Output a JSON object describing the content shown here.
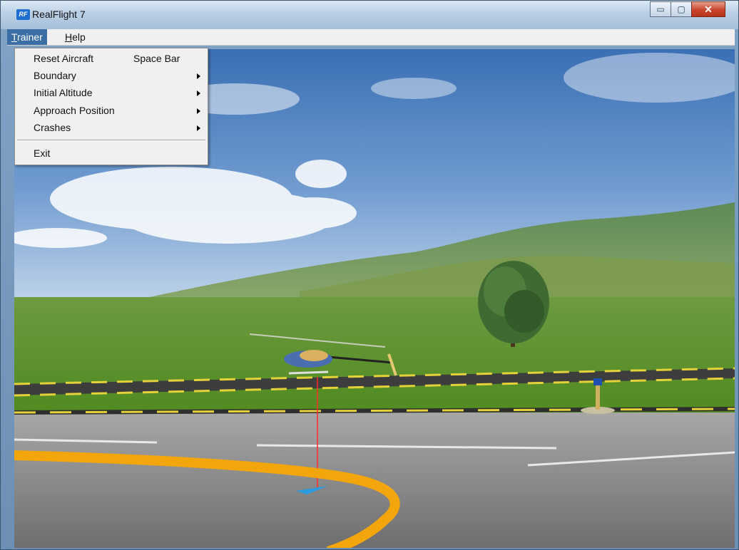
{
  "app": {
    "title": "RealFlight 7",
    "logo_text": "RF"
  },
  "window_controls": {
    "minimize": "▭",
    "maximize": "▢",
    "close": "✕"
  },
  "menubar": {
    "items": [
      {
        "label": "Trainer",
        "mnemonic": "T",
        "rest": "rainer"
      },
      {
        "label": "Help",
        "mnemonic": "H",
        "rest": "elp"
      }
    ]
  },
  "trainer_menu": {
    "items": [
      {
        "label": "Reset Aircraft",
        "shortcut": "Space Bar",
        "submenu": false
      },
      {
        "label": "Boundary",
        "shortcut": "",
        "submenu": true
      },
      {
        "label": "Initial Altitude",
        "shortcut": "",
        "submenu": true
      },
      {
        "label": "Approach Position",
        "shortcut": "",
        "submenu": true
      },
      {
        "label": "Crashes",
        "shortcut": "",
        "submenu": true
      },
      {
        "label": "Exit",
        "shortcut": "",
        "submenu": false
      }
    ]
  },
  "colors": {
    "menu_highlight": "#3a6ea5",
    "sky_top": "#3f73b8",
    "sky_horizon": "#b7cde6",
    "grass": "#5f8f2c",
    "asphalt": "#8a8a8a",
    "landing_ring": "#f2a60c",
    "altitude_line": "#ff2a2a"
  }
}
